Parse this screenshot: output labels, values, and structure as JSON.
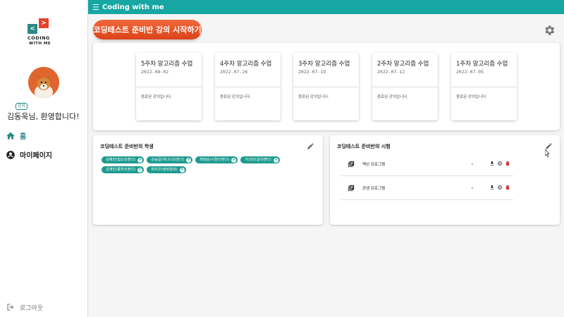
{
  "app": {
    "title": "Coding with me"
  },
  "logo": {
    "left_glyph": "<",
    "right_glyph": ">",
    "line1": "CODING",
    "line2": "WITH ME"
  },
  "profile": {
    "role_badge": "강사",
    "welcome": "김동욱님, 환영합니다!"
  },
  "nav": {
    "home": "홈",
    "mypage": "마이페이지",
    "logout": "로그아웃"
  },
  "main": {
    "start_button": "코딩테스트 준비반 강의 시작하기",
    "lessons": [
      {
        "title": "5주차 알고리즘 수업",
        "date": "2022-08-02",
        "status": "종료된 강의입니다."
      },
      {
        "title": "4주차 알고리즘 수업",
        "date": "2022-07-26",
        "status": "종료된 강의입니다."
      },
      {
        "title": "3주차 알고리즘 수업",
        "date": "2022-07-19",
        "status": "종료된 강의입니다."
      },
      {
        "title": "2주차 알고리즘 수업",
        "date": "2022-07-12",
        "status": "종료된 강의입니다."
      },
      {
        "title": "1주차 알고리즘 수업",
        "date": "2022-07-05",
        "status": "종료된 강의입니다."
      }
    ],
    "students_panel": {
      "title": "코딩테스트 준비반의 학생",
      "students": [
        "김혜진(힘쇼잇켄다)",
        "강승길(하나니잇켄다)",
        "최태순(사원잇켄다)",
        "이성민(글잇켄다)",
        "김계빈(종자잇켄다)",
        "최지우(정락임마)"
      ]
    },
    "exams_panel": {
      "title": "코딩테스트 준비반의 시험",
      "exams": [
        {
          "name": "백선 프로그램"
        },
        {
          "name": "공생 프로그램"
        }
      ]
    }
  },
  "colors": {
    "topbar": "#16a7a3",
    "accent": "#2a8a87",
    "start_button": "#e9532a",
    "chip": "#1d9a8f",
    "delete": "#d32f2f"
  }
}
